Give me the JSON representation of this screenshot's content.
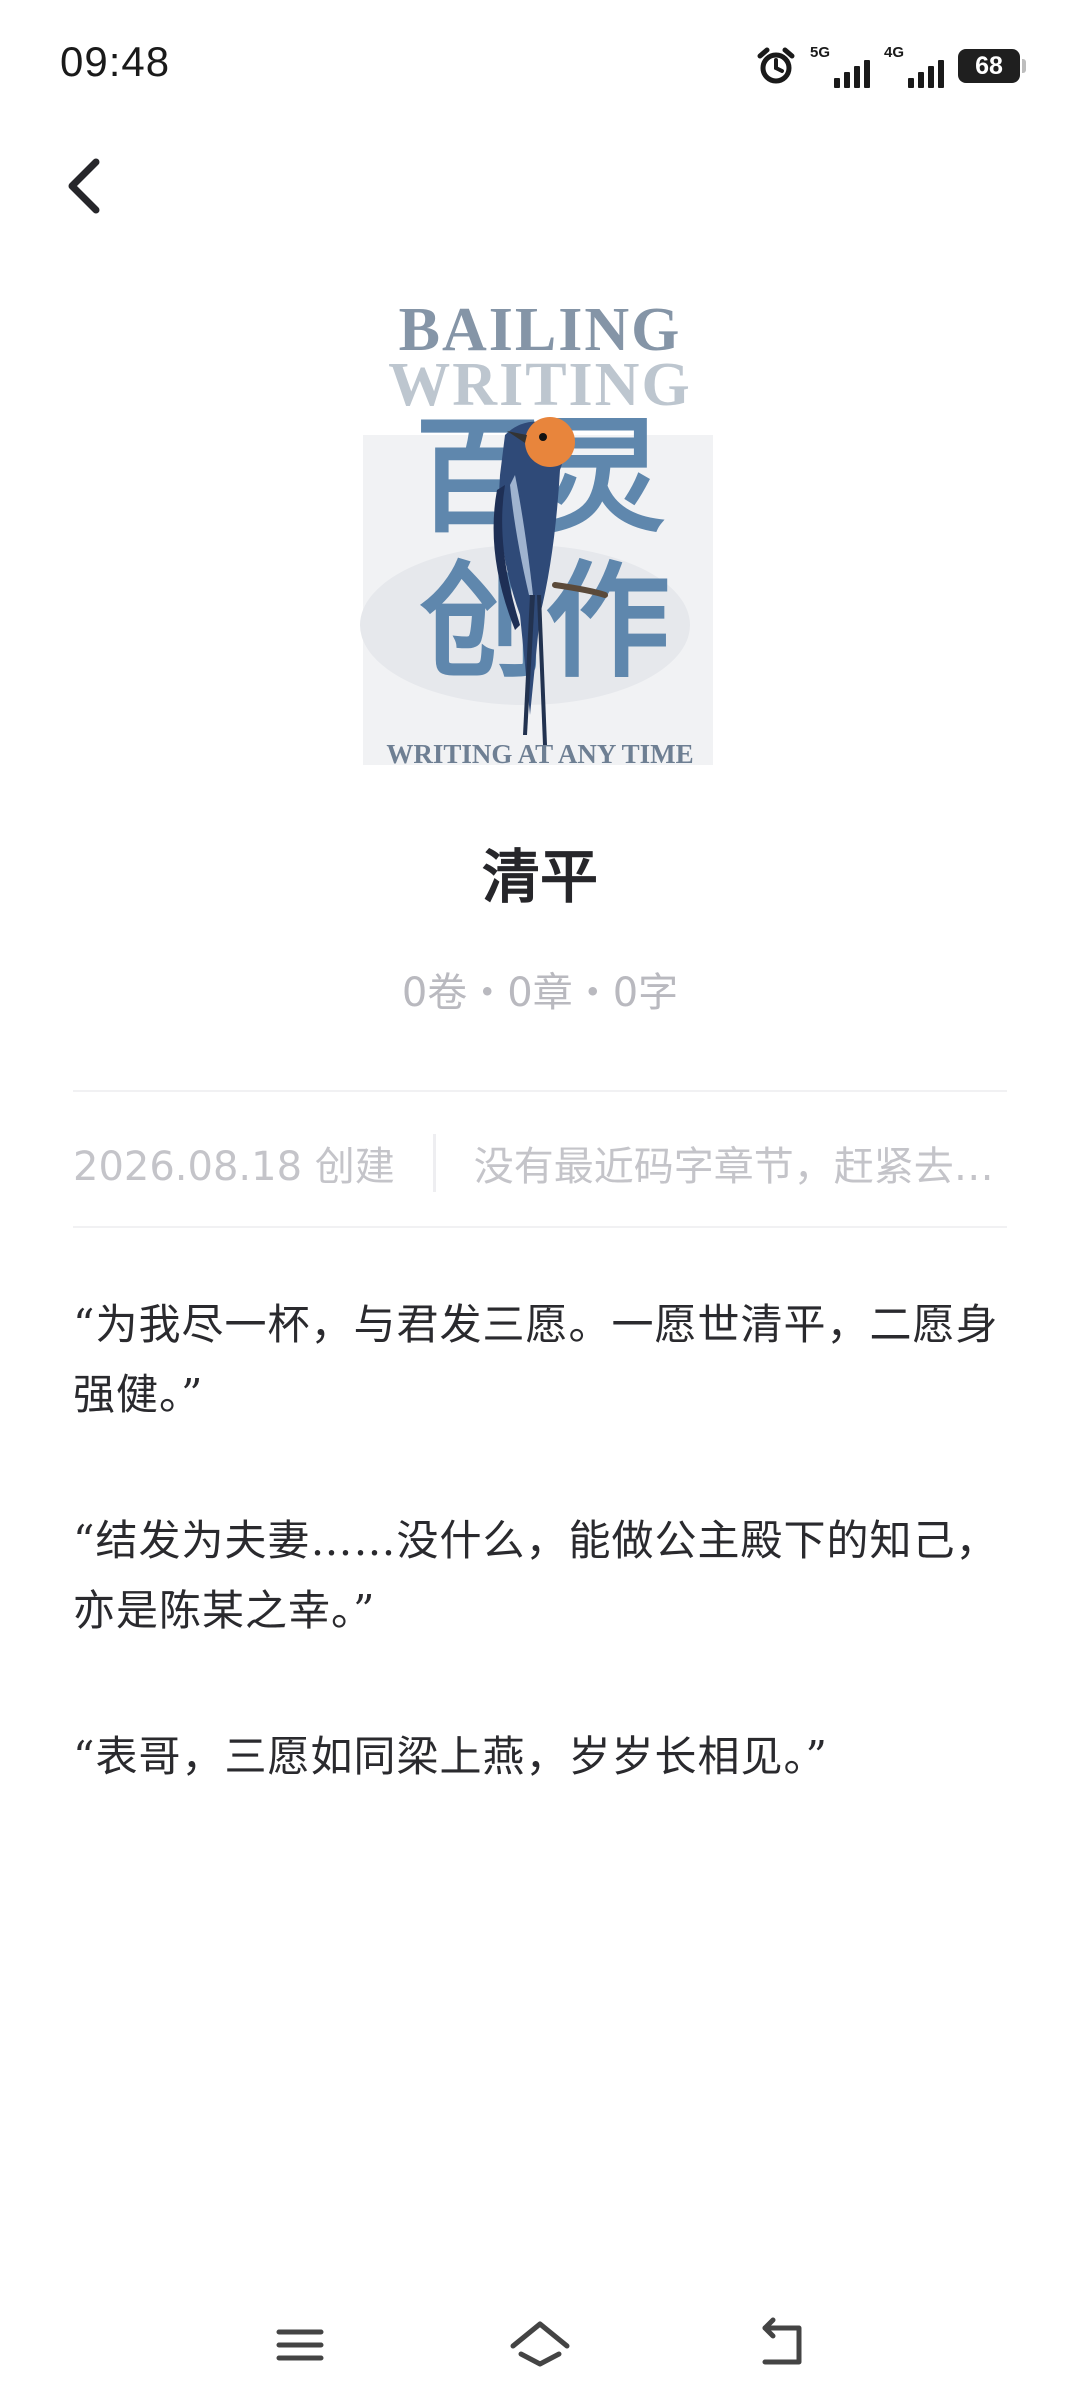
{
  "status_bar": {
    "time": "09:48",
    "net1": "5G",
    "net2": "4G",
    "battery": "68"
  },
  "header": {
    "back_icon": "chevron-left-icon"
  },
  "cover": {
    "line1": "BAILING",
    "line2": "WRITING",
    "big_chars_top": "百灵",
    "big_chars_bottom": "创作",
    "tagline": "WRITING AT ANY TIME"
  },
  "book": {
    "title": "清平",
    "stats": "0卷・0章・0字",
    "created": "2026.08.18 创建",
    "recent_chapter": "没有最近码字章节，赶紧去码字吧"
  },
  "synopsis": [
    "“为我尽一杯，与君发三愿。一愿世清平，二愿身强健。”",
    "“结发为夫妻……没什么，能做公主殿下的知己，亦是陈某之幸。”",
    "“表哥，三愿如同梁上燕，岁岁长相见。”"
  ],
  "nav": {
    "menu_icon": "menu-icon",
    "home_icon": "home-icon",
    "back_icon": "back-icon"
  },
  "colors": {
    "accent_blue": "#5f87ad",
    "bird_orange": "#e8853c",
    "text_dark": "#26262a",
    "text_muted": "#c4c4c9"
  }
}
